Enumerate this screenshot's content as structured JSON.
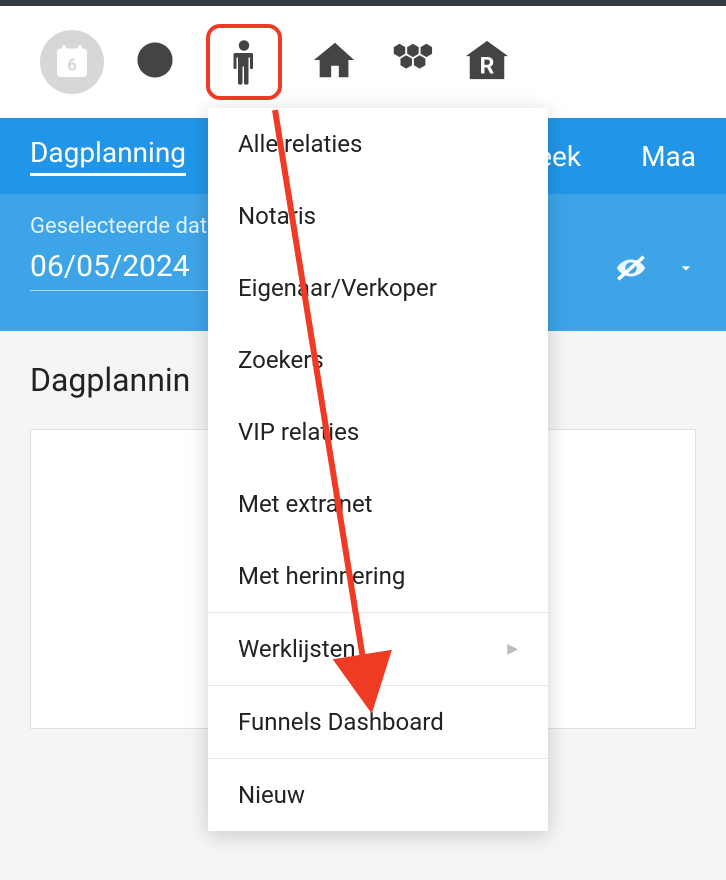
{
  "toolbar": {
    "calendar_date": "6"
  },
  "tabs": {
    "active": "Dagplanning",
    "tab1": "Dagplanning",
    "tab2": "week",
    "tab3": "Maa"
  },
  "date_picker": {
    "label": "Geselecteerde dat",
    "value": "06/05/2024"
  },
  "section_title": "Dagplannin",
  "dropdown": {
    "items": [
      "Alle relaties",
      "Notaris",
      "Eigenaar/Verkoper",
      "Zoekers",
      "VIP relaties",
      "Met extranet",
      "Met herinnering",
      "Werklijsten",
      "Funnels Dashboard",
      "Nieuw"
    ]
  }
}
